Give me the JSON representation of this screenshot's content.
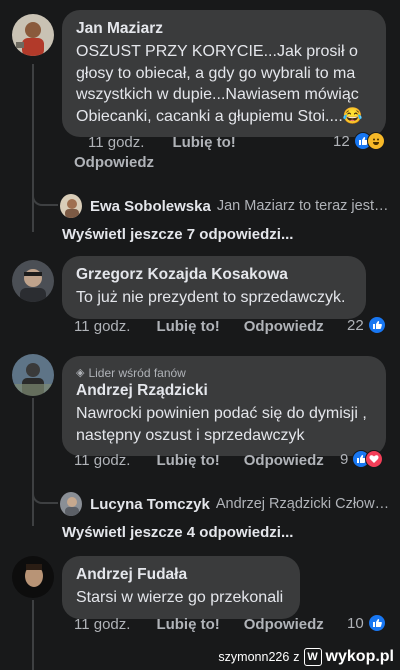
{
  "comments": [
    {
      "author": "Jan Maziarz",
      "text": "OSZUST PRZY KORYCIE...Jak prosił o głosy to obiecał, a gdy go wybrali to ma wszystkich w dupie...Nawiasem mówiąc Obiecanki, cacanki a głupiemu Stoi....😂",
      "time": "11 godz.",
      "like": "Lubię to!",
      "reply": "Odpowiedz",
      "reaction_count": "12",
      "reaction_icons": [
        "like-icon",
        "haha-icon"
      ],
      "reply_preview": {
        "author": "Ewa Sobolewska",
        "text": "Jan Maziarz to teraz jest po..."
      },
      "view_more": "Wyświetl jeszcze 7 odpowiedzi..."
    },
    {
      "author": "Grzegorz Kozajda Kosakowa",
      "text": "To już nie prezydent to sprzedawczyk.",
      "time": "11 godz.",
      "like": "Lubię to!",
      "reply": "Odpowiedz",
      "reaction_count": "22",
      "reaction_icons": [
        "like-icon"
      ]
    },
    {
      "badge": "Lider wśród fanów",
      "author": "Andrzej Rządzicki",
      "text": "Nawrocki powinien podać się do dymisji , następny oszust i sprzedawczyk",
      "time": "11 godz.",
      "like": "Lubię to!",
      "reply": "Odpowiedz",
      "reaction_count": "9",
      "reaction_icons": [
        "like-icon",
        "love-icon"
      ],
      "reply_preview": {
        "author": "Lucyna Tomczyk",
        "text": "Andrzej Rządzicki Człowiek..."
      },
      "view_more": "Wyświetl jeszcze 4 odpowiedzi..."
    },
    {
      "author": "Andrzej Fudała",
      "text": "Starsi w wierze go przekonali",
      "time": "11 godz.",
      "like": "Lubię to!",
      "reply": "Odpowiedz",
      "reaction_count": "10",
      "reaction_icons": [
        "like-icon"
      ]
    }
  ],
  "watermark": {
    "user": "szymonn226",
    "sep": "z",
    "brand": "wykop.pl"
  },
  "colors": {
    "background": "#18191a",
    "bubble": "#3a3b3c",
    "like_blue": "#1877f2",
    "love_red": "#f33e58",
    "haha_yellow": "#f7b928"
  }
}
